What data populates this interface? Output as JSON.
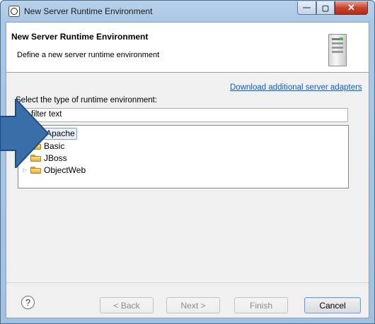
{
  "window": {
    "title": "New Server Runtime Environment",
    "controls": {
      "minimize": "—",
      "maximize": "▢",
      "close": "✕"
    }
  },
  "header": {
    "title": "New Server Runtime Environment",
    "description": "Define a new server runtime environment",
    "icon": "server-icon"
  },
  "link": {
    "download": "Download additional server adapters"
  },
  "select_label": "Select the type of runtime environment:",
  "filter": {
    "value": "pe filter text"
  },
  "tree": {
    "items": [
      {
        "label": "Apache",
        "expanded": false,
        "selected": true
      },
      {
        "label": "Basic",
        "expanded": false,
        "selected": false
      },
      {
        "label": "JBoss",
        "expanded": false,
        "selected": false
      },
      {
        "label": "ObjectWeb",
        "expanded": false,
        "selected": false
      }
    ]
  },
  "buttons": {
    "help": "?",
    "back": "< Back",
    "next": "Next >",
    "finish": "Finish",
    "cancel": "Cancel"
  },
  "colors": {
    "arrow": "#3a6ea8",
    "link": "#0b5ec7",
    "selection": "#e8f1fb"
  }
}
